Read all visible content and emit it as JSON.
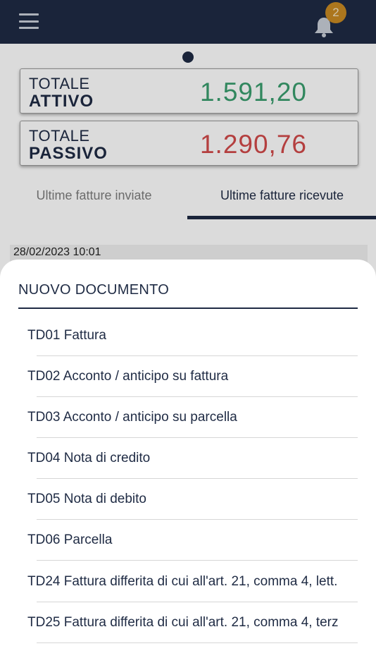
{
  "header": {
    "menu_icon": "hamburger-menu-icon",
    "notification_icon": "bell-icon",
    "notification_count": "2"
  },
  "totals": {
    "attivo": {
      "line1": "TOTALE",
      "line2": "ATTIVO",
      "amount": "1.591,20",
      "color": "#3a9e6e"
    },
    "passivo": {
      "line1": "TOTALE",
      "line2": "PASSIVO",
      "amount": "1.290,76",
      "color": "#d24a4a"
    }
  },
  "tabs": [
    {
      "label": "Ultime fatture inviate",
      "active": false
    },
    {
      "label": "Ultime fatture ricevute",
      "active": true
    }
  ],
  "list": {
    "first_date": "28/02/2023 10:01"
  },
  "sheet": {
    "title": "NUOVO DOCUMENTO",
    "items": [
      "TD01 Fattura",
      "TD02 Acconto / anticipo su fattura",
      "TD03 Acconto / anticipo su parcella",
      "TD04 Nota di credito",
      "TD05 Nota di debito",
      "TD06 Parcella",
      "TD24 Fattura differita di cui all'art. 21, comma 4, lett.",
      "TD25 Fattura differita di cui all'art. 21, comma 4, terz"
    ]
  },
  "colors": {
    "primary": "#1f2b44",
    "badge": "#c98a22",
    "positive": "#3a9e6e",
    "negative": "#d24a4a"
  }
}
